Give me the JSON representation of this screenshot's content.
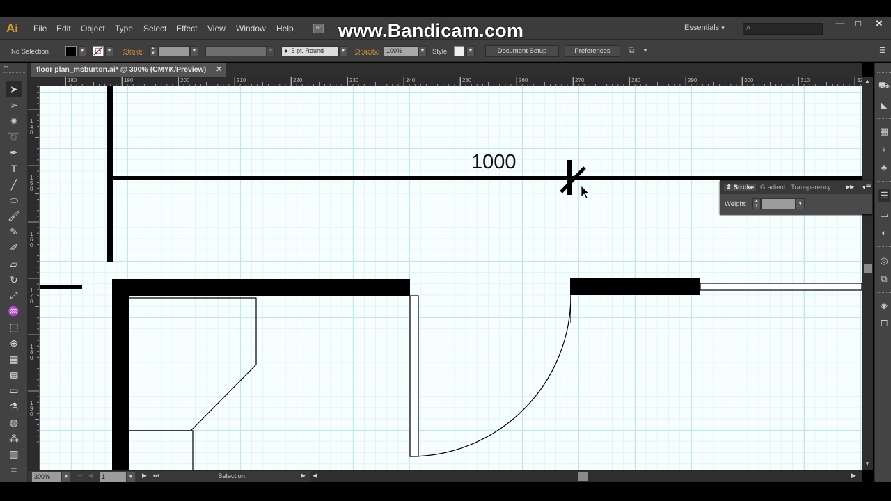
{
  "app": {
    "logo": "Ai",
    "watermark": "www.Bandicam.com",
    "bridge_icon": "Br",
    "workspace": "Essentials",
    "workspace_arrow": "▾",
    "search_placeholder": "",
    "window_controls": {
      "minimize": "—",
      "maximize": "□",
      "close": "✕"
    }
  },
  "menu": [
    "File",
    "Edit",
    "Object",
    "Type",
    "Select",
    "Effect",
    "View",
    "Window",
    "Help"
  ],
  "control_bar": {
    "selection_label": "No Selection",
    "fill_color": "#000000",
    "stroke_label": "Stroke:",
    "stroke_weight": "",
    "brush": "5 pt. Round",
    "opacity_label": "Opacity:",
    "opacity_value": "100%",
    "style_label": "Style:",
    "document_setup": "Document Setup",
    "preferences": "Preferences"
  },
  "document_tab": {
    "title": "floor plan_msburton.ai* @ 300% (CMYK/Preview)",
    "close": "✕"
  },
  "rulers": {
    "horizontal": [
      "180",
      "190",
      "200",
      "210",
      "220",
      "230",
      "240",
      "250",
      "260",
      "270",
      "280",
      "290",
      "300",
      "310",
      "32"
    ],
    "vertical": [
      "140",
      "150",
      "160",
      "170",
      "180",
      "190"
    ]
  },
  "tools": [
    {
      "name": "selection-tool",
      "glyph": "➤",
      "active": true
    },
    {
      "name": "direct-selection-tool",
      "glyph": "➢"
    },
    {
      "name": "magic-wand-tool",
      "glyph": "✷"
    },
    {
      "name": "lasso-tool",
      "glyph": "➰"
    },
    {
      "name": "pen-tool",
      "glyph": "✒"
    },
    {
      "name": "type-tool",
      "glyph": "T"
    },
    {
      "name": "line-segment-tool",
      "glyph": "╱"
    },
    {
      "name": "ellipse-tool",
      "glyph": "⬭"
    },
    {
      "name": "paintbrush-tool",
      "glyph": "🖌"
    },
    {
      "name": "pencil-tool",
      "glyph": "✎"
    },
    {
      "name": "blob-brush-tool",
      "glyph": "✐"
    },
    {
      "name": "eraser-tool",
      "glyph": "▱"
    },
    {
      "name": "rotate-tool",
      "glyph": "↻"
    },
    {
      "name": "scale-tool",
      "glyph": "⤢"
    },
    {
      "name": "warp-tool",
      "glyph": "♒"
    },
    {
      "name": "free-transform-tool",
      "glyph": "⬚"
    },
    {
      "name": "shape-builder-tool",
      "glyph": "⊕"
    },
    {
      "name": "perspective-grid-tool",
      "glyph": "▦"
    },
    {
      "name": "mesh-tool",
      "glyph": "▩"
    },
    {
      "name": "gradient-tool",
      "glyph": "▭"
    },
    {
      "name": "eyedropper-tool",
      "glyph": "⚗"
    },
    {
      "name": "blend-tool",
      "glyph": "◍"
    },
    {
      "name": "symbol-sprayer-tool",
      "glyph": "⁂"
    },
    {
      "name": "column-graph-tool",
      "glyph": "▥"
    },
    {
      "name": "artboard-tool",
      "glyph": "⌗"
    }
  ],
  "canvas": {
    "dimension_label": "1000"
  },
  "stroke_panel": {
    "tabs": [
      "Stroke",
      "Gradient",
      "Transparency"
    ],
    "weight_label": "Weight:",
    "weight_value": ""
  },
  "status_bar": {
    "zoom": "300%",
    "artboard": "1",
    "current_tool": "Selection"
  }
}
